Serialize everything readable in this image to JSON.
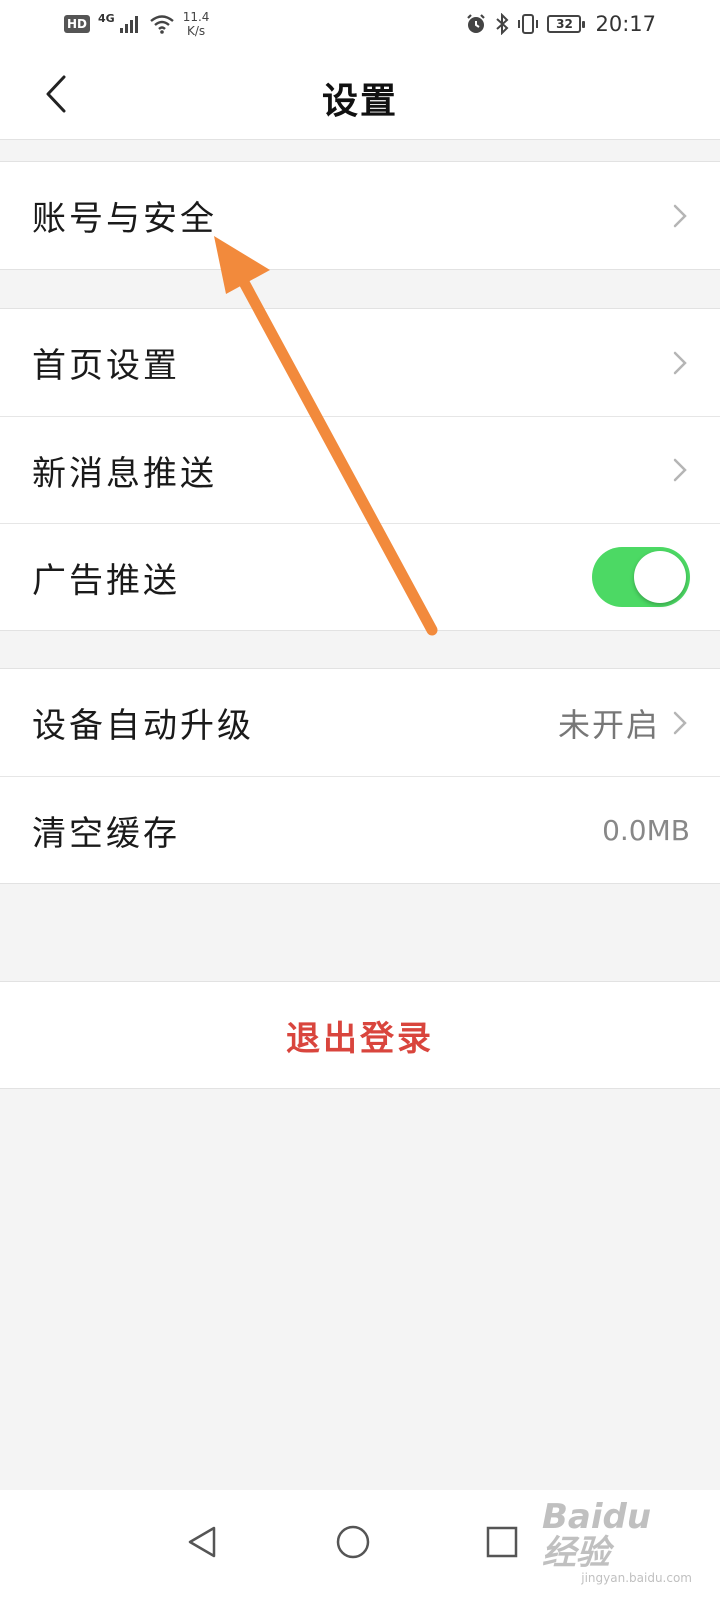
{
  "status_bar": {
    "hd": "HD",
    "network": "4G",
    "speed_value": "11.4",
    "speed_unit": "K/s",
    "battery": "32",
    "time": "20:17"
  },
  "header": {
    "title": "设置"
  },
  "groups": [
    {
      "rows": [
        {
          "label": "账号与安全",
          "chevron": true
        }
      ]
    },
    {
      "rows": [
        {
          "label": "首页设置",
          "chevron": true
        },
        {
          "label": "新消息推送",
          "chevron": true
        },
        {
          "label": "广告推送",
          "toggle_on": true
        }
      ]
    },
    {
      "rows": [
        {
          "label": "设备自动升级",
          "value": "未开启",
          "chevron": true
        },
        {
          "label": "清空缓存",
          "value": "0.0MB"
        }
      ]
    }
  ],
  "logout": {
    "label": "退出登录"
  },
  "colors": {
    "toggle_on": "#4cd964",
    "logout_text": "#d9453d",
    "annotation_arrow": "#f28a3c",
    "background": "#f4f4f4"
  },
  "watermark": {
    "main": "Baidu 经验",
    "sub": "jingyan.baidu.com"
  }
}
